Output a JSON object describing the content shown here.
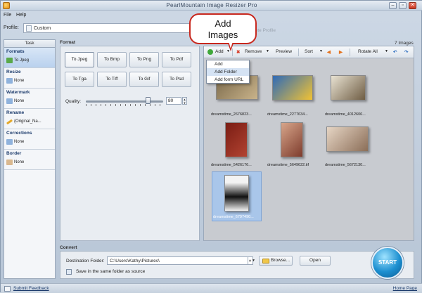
{
  "window": {
    "title": "PearlMountain Image Resizer Pro"
  },
  "menu": {
    "file": "File",
    "help": "Help"
  },
  "profile": {
    "label": "Profile:",
    "value": "Custom",
    "delete_label": "Delete Profile"
  },
  "tasks": {
    "header": "Task",
    "items": [
      {
        "name": "Formats",
        "value": "To Jpeg"
      },
      {
        "name": "Resize",
        "value": "None"
      },
      {
        "name": "Watermark",
        "value": "None"
      },
      {
        "name": "Rename",
        "value": "{Original_Na..."
      },
      {
        "name": "Corrections",
        "value": "None"
      },
      {
        "name": "Border",
        "value": "None"
      }
    ]
  },
  "format": {
    "title": "Format",
    "buttons": [
      "To Jpeg",
      "To Bmp",
      "To Png",
      "To Pdf",
      "To Tga",
      "To Tiff",
      "To Gif",
      "To Psd"
    ],
    "quality_label": "Quality:",
    "quality_value": "80",
    "quality_percent": 80
  },
  "images": {
    "count_label": "7 Images",
    "toolbar": {
      "add": "Add",
      "remove": "Remove",
      "preview": "Preview",
      "sort": "Sort",
      "rotate_all": "Rotate All"
    },
    "dropdown": [
      "Add",
      "Add Folder",
      "Add form URL"
    ],
    "thumbnails": [
      {
        "caption": "dreamstime_2676823...",
        "colors": [
          "#7b6a4c",
          "#c9b38a"
        ]
      },
      {
        "caption": "dreamstime_2277634...",
        "colors": [
          "#2e6ab8",
          "#f1c233"
        ]
      },
      {
        "caption": "dreamstime_4012606...",
        "colors": [
          "#e8e2d2",
          "#6f5d44"
        ]
      },
      {
        "caption": "dreamstime_5426176...",
        "colors": [
          "#7a1d14",
          "#b24331"
        ]
      },
      {
        "caption": "dreamstime_5649622.tif",
        "colors": [
          "#d7a58a",
          "#7d3b2c"
        ]
      },
      {
        "caption": "dreamstime_5672130...",
        "colors": [
          "#e6d5c4",
          "#8b6e58"
        ]
      },
      {
        "caption": "dreamstime_6797490...",
        "colors": [
          "#f3f3f3",
          "#111111"
        ]
      }
    ]
  },
  "callout": {
    "line1": "Add",
    "line2": "Images"
  },
  "convert": {
    "title": "Convert",
    "dest_label": "Destination Folder:",
    "dest_value": "C:\\Users\\Kathy\\Pictures\\",
    "browse": "Browse...",
    "open": "Open",
    "same_folder": "Save in the same folder as source",
    "start": "START"
  },
  "status": {
    "submit": "Submit Feedback",
    "homepage": "Home Page"
  },
  "colors": {
    "accent": "#1b3a6b",
    "callout_border": "#c8281e",
    "selection": "#a9c6ea"
  }
}
